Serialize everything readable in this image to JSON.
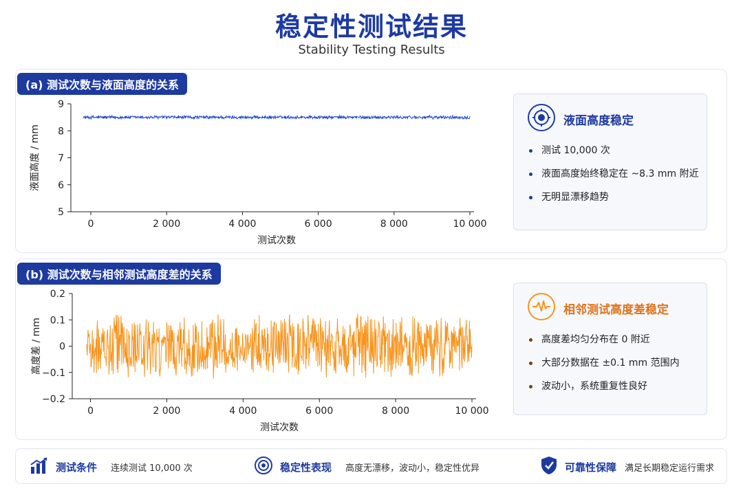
{
  "header": {
    "title": "稳定性测试结果",
    "subtitle": "Stability Testing Results"
  },
  "panel_a": {
    "tag": "(a) 测试次数与液面高度的关系",
    "card": {
      "title": "液面高度稳定",
      "bullets": [
        "测试 10,000 次",
        "液面高度始终稳定在 ~8.3 mm 附近",
        "无明显漂移趋势"
      ]
    }
  },
  "panel_b": {
    "tag": "(b) 测试次数与相邻测试高度差的关系",
    "card": {
      "title": "相邻测试高度差稳定",
      "bullets": [
        "高度差均匀分布在 0 附近",
        "大部分数据在 ±0.1 mm 范围内",
        "波动小，系统重复性良好"
      ]
    }
  },
  "footer": {
    "items": [
      {
        "label": "测试条件",
        "value": "连续测试 10,000 次"
      },
      {
        "label": "稳定性表现",
        "value": "高度无漂移，波动小，稳定性优异"
      },
      {
        "label": "可靠性保障",
        "value": "满足长期稳定运行需求"
      }
    ]
  },
  "colors": {
    "brand": "#1d3aa0",
    "series_a": "#1f45d6",
    "series_b": "#f7941d"
  },
  "chart_data": [
    {
      "type": "line",
      "xlabel": "测试次数",
      "ylabel": "液面高度 / mm",
      "xlim": [
        -200,
        10000
      ],
      "ylim": [
        5,
        9
      ],
      "xticks": [
        0,
        2000,
        4000,
        6000,
        8000,
        10000
      ],
      "xtick_labels": [
        "0",
        "2 000",
        "4 000",
        "6 000",
        "8 000",
        "10 000"
      ],
      "yticks": [
        5,
        6,
        7,
        8,
        9
      ],
      "ytick_labels": [
        "5",
        "6",
        "7",
        "8",
        "9"
      ],
      "series": [
        {
          "x_range": [
            -200,
            10000
          ],
          "mean": 8.5,
          "noise": 0.07
        }
      ]
    },
    {
      "type": "line",
      "xlabel": "测试次数",
      "ylabel": "高度差 / mm",
      "xlim": [
        -100,
        10000
      ],
      "ylim": [
        -0.2,
        0.2
      ],
      "xticks": [
        0,
        2000,
        4000,
        6000,
        8000,
        10000
      ],
      "xtick_labels": [
        "0",
        "2 000",
        "4 000",
        "6 000",
        "8 000",
        "10 000"
      ],
      "yticks": [
        -0.2,
        -0.1,
        0,
        0.1,
        0.2
      ],
      "ytick_labels": [
        "−0.2",
        "−0.1",
        "0",
        "0.1",
        "0.2"
      ],
      "series": [
        {
          "x_range": [
            -100,
            10000
          ],
          "mean": 0,
          "noise": 0.13
        }
      ]
    }
  ]
}
